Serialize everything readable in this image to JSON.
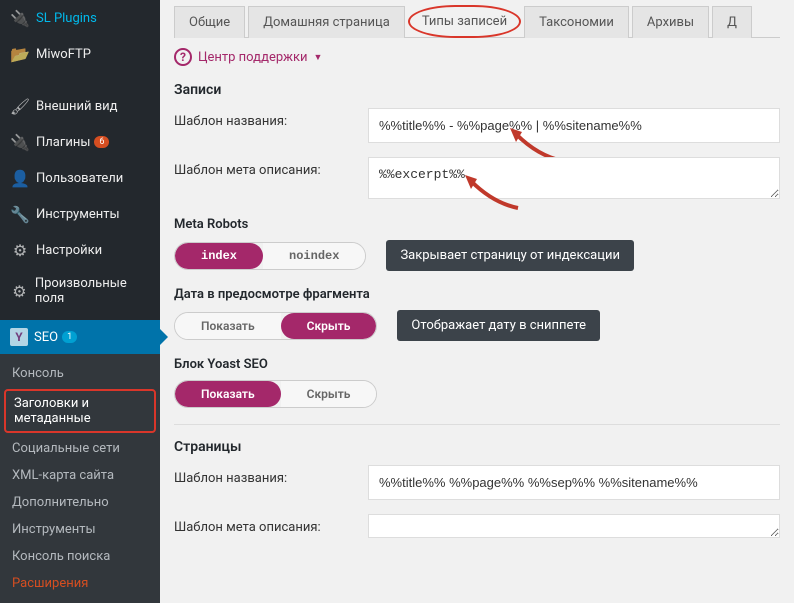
{
  "sidebar": {
    "items": [
      {
        "label": "SL Plugins",
        "icon": "🔌"
      },
      {
        "label": "MiwoFTP",
        "icon": "📁"
      },
      {
        "label": "Внешний вид",
        "icon": "🖌"
      },
      {
        "label": "Плагины",
        "icon": "🔌",
        "badge": "6"
      },
      {
        "label": "Пользователи",
        "icon": "👤"
      },
      {
        "label": "Инструменты",
        "icon": "🔧"
      },
      {
        "label": "Настройки",
        "icon": "⚙"
      },
      {
        "label": "Произвольные поля",
        "icon": "⚙"
      },
      {
        "label": "SEO",
        "icon": "Y",
        "badge": "1"
      }
    ],
    "submenu": [
      {
        "label": "Консоль"
      },
      {
        "label": "Заголовки и метаданные",
        "highlight": true
      },
      {
        "label": "Социальные сети"
      },
      {
        "label": "XML-карта сайта"
      },
      {
        "label": "Дополнительно"
      },
      {
        "label": "Инструменты"
      },
      {
        "label": "Консоль поиска"
      },
      {
        "label": "Расширения",
        "orange": true
      }
    ]
  },
  "tabs": [
    {
      "label": "Общие"
    },
    {
      "label": "Домашняя страница"
    },
    {
      "label": "Типы записей",
      "active": true,
      "circled": true
    },
    {
      "label": "Таксономии"
    },
    {
      "label": "Архивы"
    },
    {
      "label": "Д"
    }
  ],
  "support": {
    "label": "Центр поддержки"
  },
  "posts": {
    "title": "Записи",
    "title_template_label": "Шаблон названия:",
    "title_template_value": "%%title%% - %%page%% | %%sitename%%",
    "meta_desc_label": "Шаблон мета описания:",
    "meta_desc_value": "%%excerpt%%"
  },
  "meta_robots": {
    "heading": "Meta Robots",
    "index": "index",
    "noindex": "noindex",
    "tooltip": "Закрывает страницу от индексации"
  },
  "date_preview": {
    "heading": "Дата в предосмотре фрагмента",
    "show": "Показать",
    "hide": "Скрыть",
    "tooltip": "Отображает дату в сниппете"
  },
  "yoast_block": {
    "heading": "Блок Yoast SEO",
    "show": "Показать",
    "hide": "Скрыть"
  },
  "pages": {
    "title": "Страницы",
    "title_template_label": "Шаблон названия:",
    "title_template_value": "%%title%% %%page%% %%sep%% %%sitename%%",
    "meta_desc_label": "Шаблон мета описания:"
  }
}
